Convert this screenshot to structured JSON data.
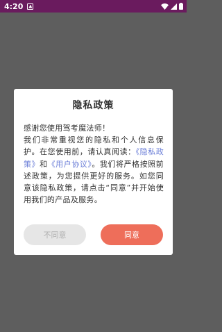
{
  "status_bar": {
    "time": "4:20",
    "background": "#6a1b5e"
  },
  "dialog": {
    "title": "隐私政策",
    "greeting": "感谢您使用驾考魔法师！",
    "body_part1": "我们非常重视您的隐私和个人信息保护。在您使用前，请认真阅读：",
    "privacy_link": "《隐私政策》",
    "and_text": "和",
    "terms_link": "《用户协议》",
    "body_part2": "。我们将严格按照前述政策，为您提供更好的服务。如您同意该隐私政策，请点击“同意”并开始使用我们的产品及服务。",
    "link_color": "#6c7fd8",
    "disagree_label": "不同意",
    "agree_label": "同意",
    "agree_color": "#ee6e5a"
  }
}
